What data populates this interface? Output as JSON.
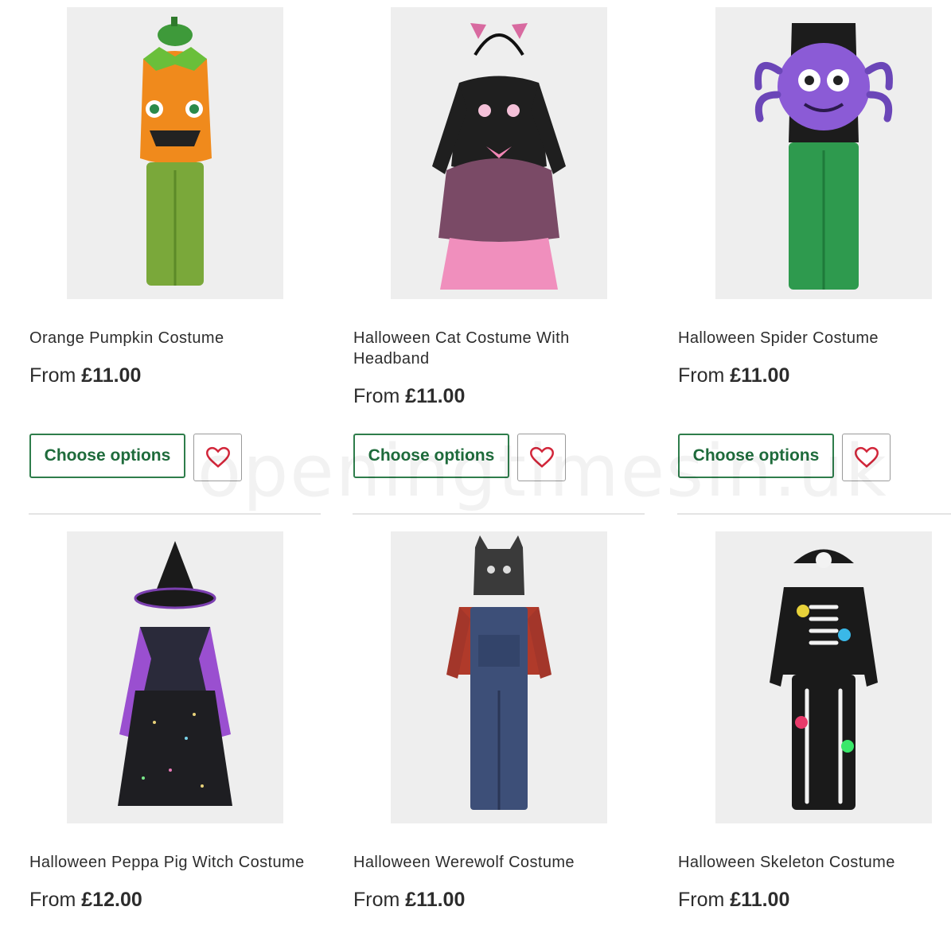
{
  "products": [
    {
      "name": "Orange Pumpkin Costume",
      "price_prefix": "From",
      "price": "£11.00",
      "cta": "Choose options",
      "icon": "heart-icon"
    },
    {
      "name": "Halloween Cat Costume With Headband",
      "price_prefix": "From",
      "price": "£11.00",
      "cta": "Choose options",
      "icon": "heart-icon"
    },
    {
      "name": "Halloween Spider Costume",
      "price_prefix": "From",
      "price": "£11.00",
      "cta": "Choose options",
      "icon": "heart-icon"
    },
    {
      "name": "Halloween Peppa Pig Witch Costume",
      "price_prefix": "From",
      "price": "£12.00"
    },
    {
      "name": "Halloween Werewolf Costume",
      "price_prefix": "From",
      "price": "£11.00"
    },
    {
      "name": "Halloween Skeleton Costume",
      "price_prefix": "From",
      "price": "£11.00"
    }
  ],
  "watermark": "openingtimesin.uk",
  "colors": {
    "accent": "#2e7d4b",
    "heart": "#d2263a",
    "image_bg": "#eeeeee"
  }
}
